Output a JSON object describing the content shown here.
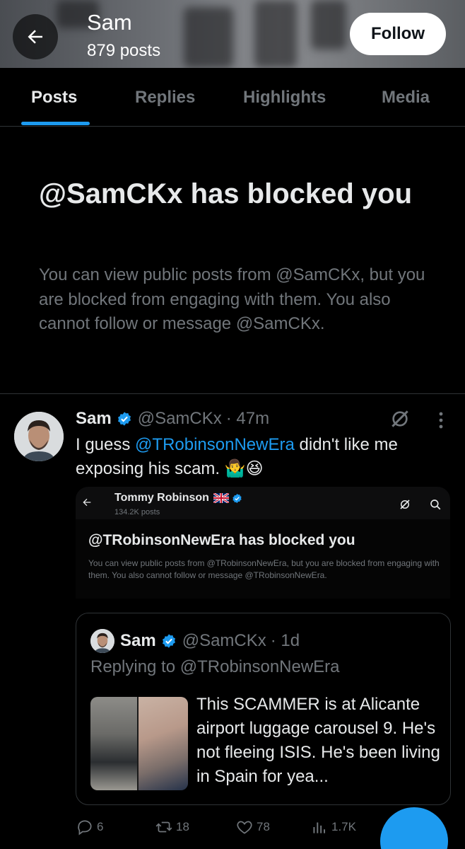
{
  "header": {
    "name": "Sam",
    "post_count": "879 posts",
    "follow_label": "Follow"
  },
  "tabs": [
    {
      "label": "Posts",
      "active": true
    },
    {
      "label": "Replies",
      "active": false
    },
    {
      "label": "Highlights",
      "active": false
    },
    {
      "label": "Media",
      "active": false
    }
  ],
  "blocked_notice": {
    "title": "@SamCKx has blocked you",
    "description": "You can view public posts from @SamCKx, but you are blocked from engaging with them. You also cannot follow or message @SamCKx."
  },
  "post": {
    "author_name": "Sam",
    "handle": "@SamCKx",
    "time": "· 47m",
    "text_before": "I guess ",
    "mention": "@TRobinsonNewEra",
    "text_after": " didn't like me exposing his scam. 🤷‍♂️😆",
    "embedded_screenshot": {
      "name": "Tommy Robinson",
      "post_count": "134.2K posts",
      "title": "@TRobinsonNewEra has blocked you",
      "description": "You can view public posts from @TRobinsonNewEra, but you are blocked from engaging with them. You also cannot follow or message @TRobinsonNewEra."
    },
    "quote": {
      "author_name": "Sam",
      "handle": "@SamCKx",
      "time": "· 1d",
      "replying_to": "Replying to @TRobinsonNewEra",
      "text": "This SCAMMER is at Alicante airport luggage carousel 9. He's not fleeing ISIS. He's been living in Spain for yea..."
    },
    "actions": {
      "replies": "6",
      "reposts": "18",
      "likes": "78",
      "views": "1.7K"
    }
  },
  "colors": {
    "accent": "#1d9bf0",
    "background": "#000000",
    "text_primary": "#e7e9ea",
    "text_secondary": "#71767b",
    "border": "#2f3336"
  }
}
